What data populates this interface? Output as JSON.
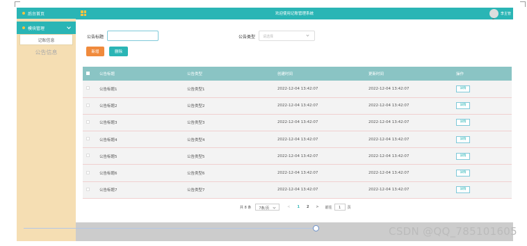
{
  "sidebar": {
    "home_label": "后台首页",
    "group_label": "模块管理",
    "items": [
      {
        "label": "记账信息"
      },
      {
        "label": "公告信息"
      }
    ]
  },
  "header": {
    "title": "欢迎使用记账管理系统",
    "user": "李主管"
  },
  "search": {
    "title_label": "公告标题",
    "title_value": "",
    "type_label": "公告类型",
    "type_placeholder": "请选择",
    "add_label": "新增",
    "delete_label": "删除"
  },
  "table": {
    "headers": [
      "公告标题",
      "公告类型",
      "创建时间",
      "更新时间",
      "操作"
    ],
    "rows": [
      {
        "title": "公告标题1",
        "type": "公告类型1",
        "created": "2022-12-04 13:42:07",
        "updated": "2022-12-04 13:42:07",
        "action": "详情"
      },
      {
        "title": "公告标题2",
        "type": "公告类型2",
        "created": "2022-12-04 13:42:07",
        "updated": "2022-12-04 13:42:07",
        "action": "详情"
      },
      {
        "title": "公告标题3",
        "type": "公告类型3",
        "created": "2022-12-04 13:42:07",
        "updated": "2022-12-04 13:42:07",
        "action": "详情"
      },
      {
        "title": "公告标题4",
        "type": "公告类型4",
        "created": "2022-12-04 13:42:07",
        "updated": "2022-12-04 13:42:07",
        "action": "详情"
      },
      {
        "title": "公告标题5",
        "type": "公告类型5",
        "created": "2022-12-04 13:42:07",
        "updated": "2022-12-04 13:42:07",
        "action": "详情"
      },
      {
        "title": "公告标题6",
        "type": "公告类型6",
        "created": "2022-12-04 13:42:07",
        "updated": "2022-12-04 13:42:07",
        "action": "详情"
      },
      {
        "title": "公告标题7",
        "type": "公告类型7",
        "created": "2022-12-04 13:42:07",
        "updated": "2022-12-04 13:42:07",
        "action": "详情"
      }
    ]
  },
  "pagination": {
    "total": "共 8 条",
    "page_size": "7条/页",
    "prev": "<",
    "pages": [
      "1",
      "2"
    ],
    "next": ">",
    "goto_label": "前往",
    "goto_value": "1",
    "page_unit": "页"
  },
  "watermark": "CSDN @QQ_785101605",
  "colors": {
    "accent": "#2ab5b5",
    "sidebar_bg": "#f5deb3",
    "add_button": "#f08a3c",
    "table_header": "#8ac4c4"
  }
}
